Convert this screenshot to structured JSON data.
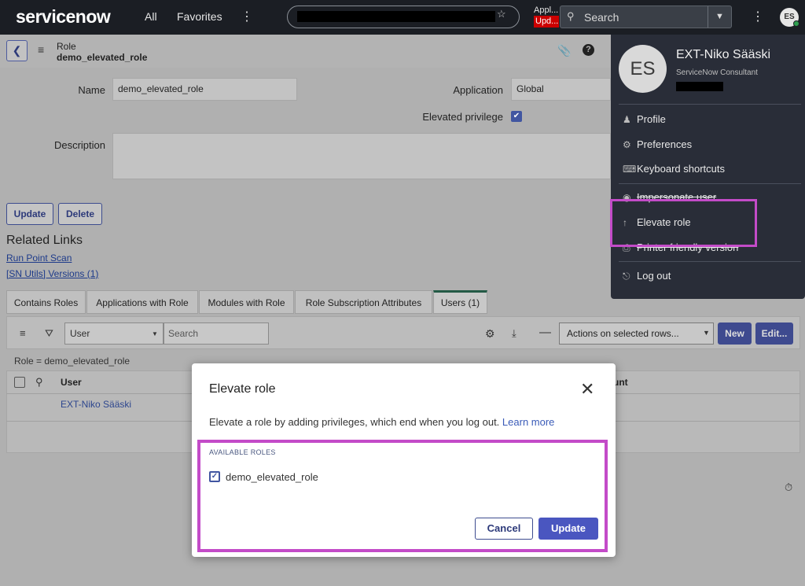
{
  "topnav": {
    "logo": "servicenow",
    "all": "All",
    "favorites": "Favorites",
    "app_scope_label": "Appl...",
    "update_badge": "Upd...",
    "search_placeholder": "Search",
    "avatar_initials": "ES"
  },
  "form": {
    "header_type": "Role",
    "header_name": "demo_elevated_role",
    "name_label": "Name",
    "name_value": "demo_elevated_role",
    "application_label": "Application",
    "application_value": "Global",
    "elevated_label": "Elevated privilege",
    "elevated_checked": true,
    "description_label": "Description",
    "update_btn": "Update",
    "delete_btn": "Delete"
  },
  "related_links": {
    "title": "Related Links",
    "links": [
      "Run Point Scan",
      "[SN Utils] Versions (1)"
    ]
  },
  "tabs": [
    "Contains Roles",
    "Applications with Role",
    "Modules with Role",
    "Role Subscription Attributes",
    "Users (1)"
  ],
  "list": {
    "filter_field": "User",
    "search_placeholder": "Search",
    "actions_placeholder": "Actions on selected rows...",
    "new_btn": "New",
    "edit_btn": "Edit...",
    "breadcrumb": "Role = demo_elevated_role",
    "col_user": "User",
    "col_count": "unt",
    "rows": [
      {
        "user": "EXT-Niko Sääski"
      }
    ]
  },
  "user_menu": {
    "initials": "ES",
    "name": "EXT-Niko Sääski",
    "title": "ServiceNow Consultant",
    "items": [
      {
        "label": "Profile",
        "icon": "person-icon"
      },
      {
        "label": "Preferences",
        "icon": "gear-icon"
      },
      {
        "label": "Keyboard shortcuts",
        "icon": "keyboard-icon"
      },
      {
        "label": "Impersonate user",
        "icon": "impersonate-icon"
      },
      {
        "label": "Elevate role",
        "icon": "arrow-up-icon"
      },
      {
        "label": "Printer friendly version",
        "icon": "printer-icon"
      },
      {
        "label": "Log out",
        "icon": "logout-icon"
      }
    ]
  },
  "modal": {
    "title": "Elevate role",
    "description": "Elevate a role by adding privileges, which end when you log out.",
    "learn_more": "Learn more",
    "available_roles_label": "AVAILABLE ROLES",
    "role": "demo_elevated_role",
    "role_checked": true,
    "cancel_btn": "Cancel",
    "update_btn": "Update"
  },
  "colors": {
    "highlight": "#c34bc8",
    "primary": "#4a56c0",
    "nav_bg": "#1b1e24",
    "menu_bg": "#292d38"
  }
}
